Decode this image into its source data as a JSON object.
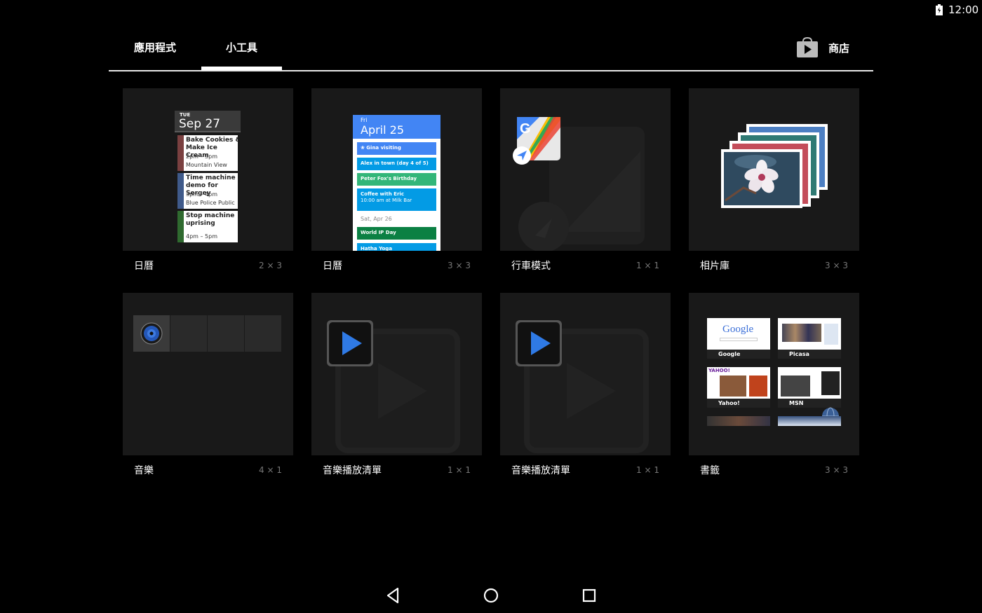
{
  "status_bar": {
    "time": "12:00",
    "battery_icon": "battery-charging-icon"
  },
  "tabs": [
    {
      "label": "應用程式",
      "selected": false
    },
    {
      "label": "小工具",
      "selected": true
    }
  ],
  "store": {
    "label": "商店",
    "icon": "play-store-icon"
  },
  "widgets": [
    {
      "name": "日曆",
      "size": "2 × 3",
      "preview": "calendar-agenda"
    },
    {
      "name": "日曆",
      "size": "3 × 3",
      "preview": "calendar-month"
    },
    {
      "name": "行車模式",
      "size": "1 × 1",
      "preview": "maps-driving"
    },
    {
      "name": "相片庫",
      "size": "3 × 3",
      "preview": "photo-stack"
    },
    {
      "name": "音樂",
      "size": "4 × 1",
      "preview": "music-strip"
    },
    {
      "name": "音樂播放清單",
      "size": "1 × 1",
      "preview": "play-button"
    },
    {
      "name": "音樂播放清單",
      "size": "1 × 1",
      "preview": "play-button"
    },
    {
      "name": "書籤",
      "size": "3 × 3",
      "preview": "bookmark-grid"
    }
  ],
  "calendar_small": {
    "dow": "TUE",
    "date": "Sep 27",
    "events": [
      {
        "title": "Bake Cookies & Make Ice Cream",
        "time": "2pm – 3pm",
        "place": "Mountain View",
        "color": "#7a4040"
      },
      {
        "title": "Time machine demo for Sergey",
        "time": "3pm – 4pm",
        "place": "Blue Police Public",
        "color": "#3f5a8a"
      },
      {
        "title": "Stop machine uprising",
        "time": "4pm – 5pm",
        "place": "",
        "color": "#2f6a2f"
      }
    ]
  },
  "calendar_large": {
    "dow": "Fri",
    "date": "April 25",
    "events": [
      {
        "title": "❀ Gina visiting",
        "color": "#4285f4"
      },
      {
        "title": "Alex in town (day 4 of 5)",
        "color": "#039be5"
      },
      {
        "title": "Peter Fox's Birthday",
        "color": "#33b679"
      },
      {
        "title": "Coffee with Eric",
        "subtitle": "10:00 am at Milk Bar",
        "color": "#039be5"
      },
      {
        "title": "World IP Day",
        "color": "#0b8043"
      },
      {
        "title": "Hatha Yoga",
        "color": "#039be5"
      }
    ],
    "separator": "Sat, Apr 26"
  },
  "bookmarks": [
    {
      "label": "Google",
      "logo": "Google"
    },
    {
      "label": "Picasa"
    },
    {
      "label": "Yahoo!",
      "logo": "YAHOO!"
    },
    {
      "label": "MSN"
    }
  ],
  "nav": {
    "back": "back-icon",
    "home": "home-icon",
    "recents": "recents-icon"
  }
}
